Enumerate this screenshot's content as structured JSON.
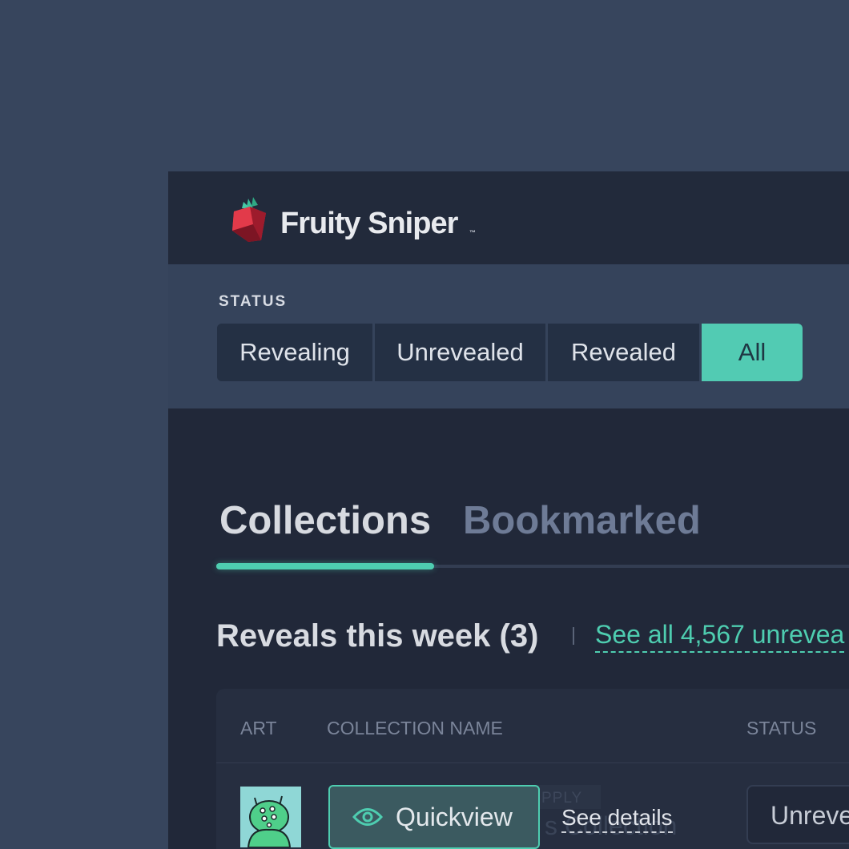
{
  "brand": {
    "name": "Fruity Sniper",
    "tm": "™",
    "icon": "strawberry-logo-icon"
  },
  "filters": {
    "label": "STATUS",
    "options": [
      "Revealing",
      "Unrevealed",
      "Revealed",
      "All"
    ],
    "selected": "All"
  },
  "tabs": [
    {
      "label": "Collections",
      "active": true
    },
    {
      "label": "Bookmarked",
      "active": false
    }
  ],
  "section": {
    "title": "Reveals this week (3)",
    "link": "See all 4,567 unrevea"
  },
  "table": {
    "columns": [
      "ART",
      "COLLECTION NAME",
      "STATUS"
    ],
    "rows": [
      {
        "art_icon": "alien-character-icon",
        "quickview_label": "Quickview",
        "quickview_icon": "eye-icon",
        "details_label": "See details",
        "status": "Unreve",
        "ghost_apply": "PPLY",
        "ghost_name": "s Collection"
      }
    ]
  },
  "colors": {
    "background": "#37455d",
    "topbar": "#222a3b",
    "accent": "#4ecdb0",
    "panel": "#212839"
  }
}
